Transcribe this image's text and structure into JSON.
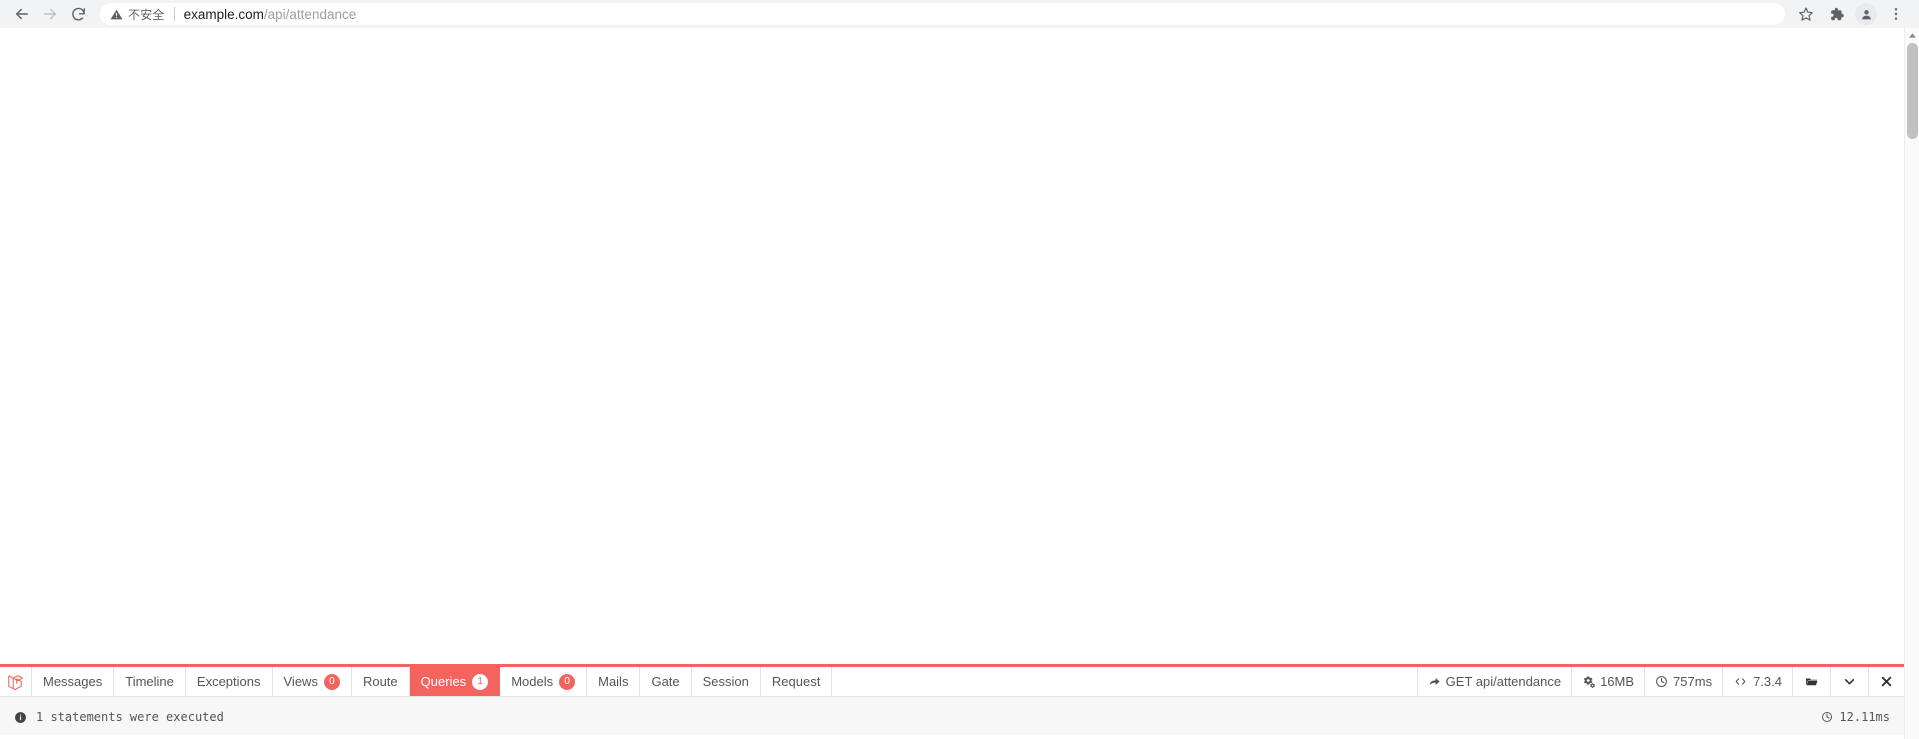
{
  "browser": {
    "back_label": "Back",
    "forward_label": "Forward",
    "reload_label": "Reload",
    "security_label": "不安全",
    "url_host": "example.com",
    "url_path": "/api/attendance",
    "bookmark_label": "Bookmark this tab",
    "extensions_label": "Extensions",
    "profile_label": "Profile",
    "menu_label": "Customize and control Google Chrome"
  },
  "debugbar": {
    "brand": "Laravel Debugbar",
    "tabs": [
      {
        "label": "Messages",
        "badge": null,
        "active": false
      },
      {
        "label": "Timeline",
        "badge": null,
        "active": false
      },
      {
        "label": "Exceptions",
        "badge": null,
        "active": false
      },
      {
        "label": "Views",
        "badge": "0",
        "active": false
      },
      {
        "label": "Route",
        "badge": null,
        "active": false
      },
      {
        "label": "Queries",
        "badge": "1",
        "active": true
      },
      {
        "label": "Models",
        "badge": "0",
        "active": false
      },
      {
        "label": "Mails",
        "badge": null,
        "active": false
      },
      {
        "label": "Gate",
        "badge": null,
        "active": false
      },
      {
        "label": "Session",
        "badge": null,
        "active": false
      },
      {
        "label": "Request",
        "badge": null,
        "active": false
      }
    ],
    "stats": {
      "request": "GET api/attendance",
      "memory": "16MB",
      "time": "757ms",
      "php_version": "7.3.4"
    },
    "controls": {
      "open_label": "Open",
      "minimize_label": "Minimize",
      "close_label": "Close"
    },
    "status": {
      "message": "1 statements were executed",
      "duration": "12.11ms"
    }
  },
  "colors": {
    "accent": "#f4645f",
    "badge": "#f4645f",
    "chrome_bg": "#f1f3f4",
    "status_bg": "#f7f7f7",
    "text": "#555555"
  }
}
